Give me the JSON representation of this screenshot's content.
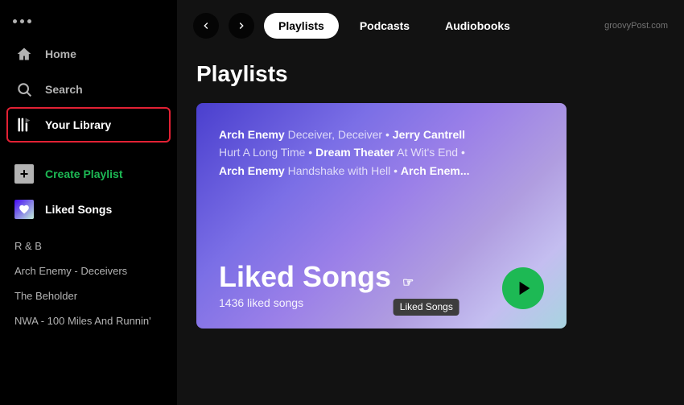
{
  "sidebar": {
    "dots_label": "More options",
    "nav": {
      "home_label": "Home",
      "search_label": "Search",
      "your_library_label": "Your Library"
    },
    "create_playlist_label": "Create Playlist",
    "liked_songs_label": "Liked Songs",
    "playlists": [
      {
        "name": "R & B"
      },
      {
        "name": "Arch Enemy - Deceivers"
      },
      {
        "name": "The Beholder"
      },
      {
        "name": "NWA - 100 Miles And Runnin'"
      }
    ]
  },
  "topbar": {
    "back_label": "‹",
    "forward_label": "›",
    "tabs": [
      {
        "id": "playlists",
        "label": "Playlists",
        "active": true
      },
      {
        "id": "podcasts",
        "label": "Podcasts",
        "active": false
      },
      {
        "id": "audiobooks",
        "label": "Audiobooks",
        "active": false
      }
    ],
    "watermark": "groovyPost.com"
  },
  "main": {
    "section_title": "Playlists",
    "liked_songs_card": {
      "tracks_line1_artist": "Arch Enemy",
      "tracks_line1_song": "Deceiver, Deceiver",
      "tracks_line1_sep": " • ",
      "tracks_line1_artist2": "Jerry Cantrell",
      "tracks_line2_song": "Hurt A Long Time",
      "tracks_line2_sep": " • ",
      "tracks_line2_artist": "Dream Theater",
      "tracks_line2_song2": "At Wit's End",
      "tracks_line2_sep2": " • ",
      "tracks_line3_artist": "Arch Enemy",
      "tracks_line3_song": "Handshake with Hell",
      "tracks_line3_sep": " • ",
      "tracks_line3_artist2": "Arch Enem...",
      "title": "Liked Songs",
      "subtitle": "1436 liked songs",
      "tooltip": "Liked Songs"
    }
  }
}
